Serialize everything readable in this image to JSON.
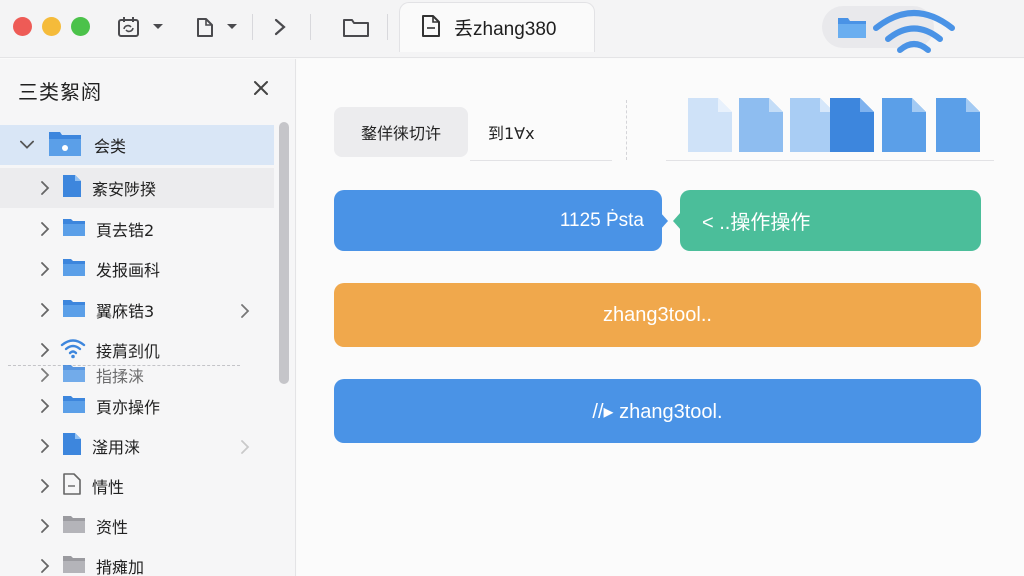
{
  "titlebar": {
    "tab_title": "丢zhang380",
    "colors": {
      "close": "#ee5b56",
      "minimize": "#f5bb3a",
      "maximize": "#4bc24a"
    }
  },
  "sidebar": {
    "title": "三类絮阏",
    "items": [
      {
        "label": "会类",
        "icon": "folder-icon",
        "expanded": true,
        "selected": true
      },
      {
        "label": "紊安陟揆",
        "icon": "document-icon"
      },
      {
        "label": "頁去锆2",
        "icon": "folder-icon"
      },
      {
        "label": "发报画科",
        "icon": "folder-icon"
      },
      {
        "label": "翼庥锆3",
        "icon": "folder-icon",
        "has_submenu": true
      },
      {
        "label": "接菺刭仉",
        "icon": "wifi-icon"
      },
      {
        "label": "指揉涞",
        "icon": "folder-icon"
      },
      {
        "label": "頁亦操作",
        "icon": "folder-icon"
      },
      {
        "label": "滏用涞",
        "icon": "document-icon",
        "has_submenu": true
      },
      {
        "label": "情性",
        "icon": "document-outline-icon"
      },
      {
        "label": "资性",
        "icon": "folder-gray-icon"
      },
      {
        "label": "揹瘫加",
        "icon": "folder-gray-icon"
      }
    ]
  },
  "main": {
    "segment_button": "鍪佯徕切许",
    "segment_text": "到1∀x",
    "bars": {
      "bar1": "1125 Ṗsta",
      "bar2": "< ..操作操作",
      "bar3": "zhang3tool..",
      "bar4": "//▸ zhang3tool."
    },
    "colors": {
      "blue": "#4a93e6",
      "green": "#4bbe9a",
      "orange": "#f0a84c"
    }
  }
}
